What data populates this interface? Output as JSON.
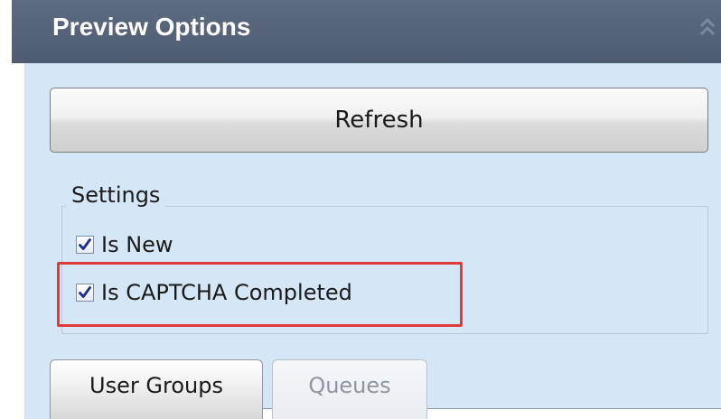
{
  "panel": {
    "title": "Preview Options",
    "collapse_icon": "double-chevron-up-icon"
  },
  "actions": {
    "refresh_label": "Refresh"
  },
  "settings": {
    "legend": "Settings",
    "items": [
      {
        "label": "Is New",
        "checked": true
      },
      {
        "label": "Is CAPTCHA Completed",
        "checked": true,
        "highlighted": true
      }
    ]
  },
  "tabs": [
    {
      "label": "User Groups",
      "active": true
    },
    {
      "label": "Queues",
      "active": false
    }
  ],
  "colors": {
    "header": "#56647a",
    "body": "#d5e6f7",
    "highlight": "#e03a3a",
    "checkmark": "#1f2f86"
  }
}
